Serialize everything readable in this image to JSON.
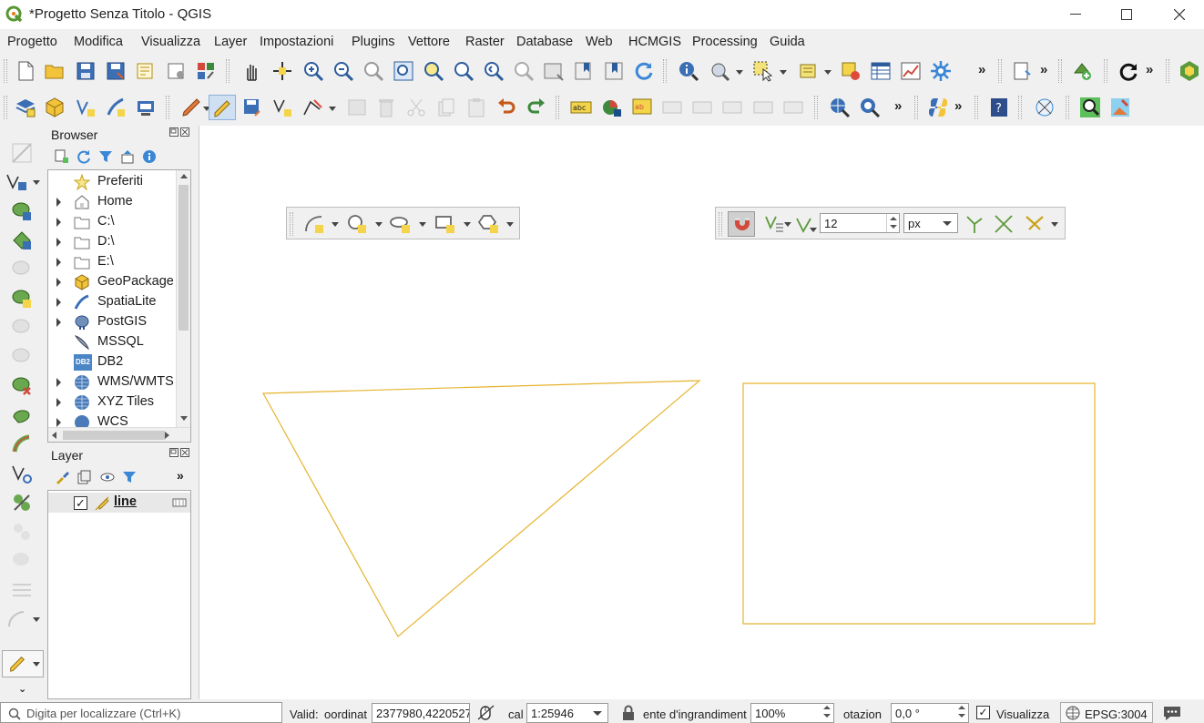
{
  "window": {
    "title": "*Progetto Senza Titolo - QGIS",
    "minimize_glyph": "—",
    "maximize_glyph": "☐",
    "close_glyph": "✕"
  },
  "menu": [
    "Progetto",
    "Modifica",
    "Visualizza",
    "Layer",
    "Impostazioni",
    "Plugins",
    "Vettore",
    "Raster",
    "Database",
    "Web",
    "HCMGIS",
    "Processing",
    "Guida"
  ],
  "overflow_glyph": "»",
  "browser_panel": {
    "title": "Browser",
    "items": [
      "Preferiti",
      "Home",
      "C:\\",
      "D:\\",
      "E:\\",
      "GeoPackage",
      "SpatiaLite",
      "PostGIS",
      "MSSQL",
      "DB2",
      "WMS/WMTS",
      "XYZ Tiles",
      "WCS"
    ],
    "db2_badge": "DB2"
  },
  "layer_panel": {
    "title": "Layer",
    "layers": [
      {
        "name": "line",
        "checked": true
      }
    ]
  },
  "snapping_toolbar": {
    "tolerance_value": "12",
    "unit": "px"
  },
  "statusbar": {
    "locator_placeholder": "Digita per localizzare (Ctrl+K)",
    "valid_label": "Valid:",
    "coord_label": "oordinat",
    "coordinates": "2377980,4220527",
    "scale_label": "cal",
    "scale_value": "1:25946",
    "magnifier_label": "ente d'ingrandiment",
    "magnifier_value": "100%",
    "rotation_label": "otazion",
    "rotation_value": "0,0 °",
    "render_label": "Visualizza",
    "render_checked": true,
    "crs": "EPSG:3004"
  },
  "map_features": {
    "stroke_color": "#e6b32e",
    "shapes": [
      "triangle",
      "rectangle"
    ]
  }
}
